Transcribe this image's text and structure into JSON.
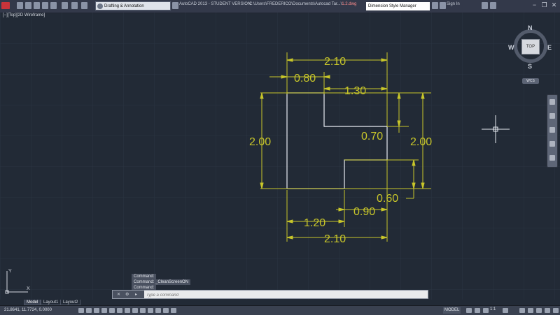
{
  "titlebar": {
    "workspace": "Drafting & Annotation",
    "app_title": "AutoCAD 2013 - STUDENT VERSION",
    "file_path": "C:\\Users\\FREDERICO\\Documents\\Autocad Tar...\\",
    "file_name": "1.2.dwg",
    "search_placeholder": "Dimension Style Manager",
    "sign_in": "Sign In",
    "minimize": "−",
    "restore": "❐",
    "close": "✕"
  },
  "viewport": {
    "label": "[−][Top][2D Wireframe]"
  },
  "viewcube": {
    "top": "TOP",
    "north": "N",
    "south": "S",
    "east": "E",
    "west": "W",
    "wcs": "WCS"
  },
  "dimensions": {
    "top_total": "2.10",
    "top_left": "0.80",
    "top_right": "1.30",
    "left_height": "2.00",
    "right_height": "2.00",
    "step_upper": "0.70",
    "step_lower": "0.60",
    "bottom_left": "1.20",
    "bottom_mid": "0.90",
    "bottom_total": "2.10"
  },
  "colors": {
    "background": "#222a36",
    "dimension": "#c8c62a",
    "geometry": "#e8ecf2",
    "grid": "#2b3441"
  },
  "command": {
    "history": [
      "Command:",
      "Command: _CleanScreenON",
      "Command:"
    ],
    "placeholder": "Type a command"
  },
  "layout_tabs": [
    "Model",
    "Layout1",
    "Layout2"
  ],
  "status": {
    "coordinates": "21.8641, 11.7724, 0.0000",
    "model": "MODEL",
    "scale": "1:1"
  }
}
